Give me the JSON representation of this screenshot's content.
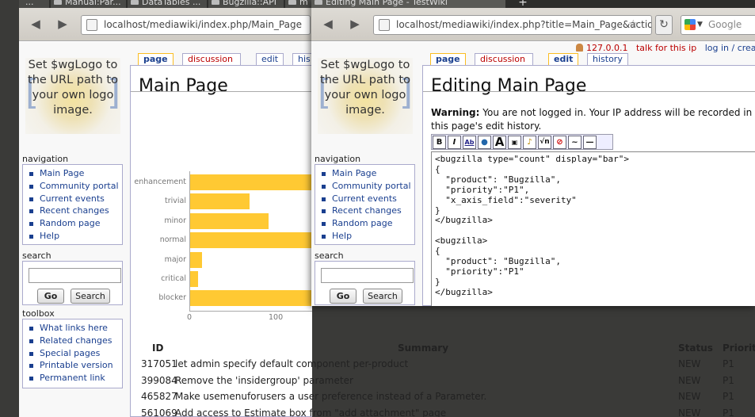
{
  "back_window": {
    "tabs": [
      "...",
      "Manual:Par...",
      "DataTables ...",
      "Bugzilla::API",
      "m"
    ],
    "url": "localhost/mediawiki/index.php/Main_Page",
    "page_tabs": {
      "page": "page",
      "discussion": "discussion",
      "edit": "edit",
      "history": "his"
    },
    "title": "Main Page",
    "bug_table": {
      "headers": {
        "id": "ID",
        "summary": "Summary",
        "status": "Status",
        "priority": "Priorit"
      },
      "rows": [
        {
          "id": "317051",
          "summary": "let admin specify default component per-product",
          "status": "NEW",
          "priority": "P1"
        },
        {
          "id": "399084",
          "summary": "Remove the 'insidergroup' parameter",
          "status": "NEW",
          "priority": "P1"
        },
        {
          "id": "465827",
          "summary": "Make usemenuforusers a user preference instead of a Parameter.",
          "status": "NEW",
          "priority": "P1"
        },
        {
          "id": "561069",
          "summary": "Add access to Estimate box from \"add attachment\" page",
          "status": "NEW",
          "priority": "P1"
        }
      ]
    }
  },
  "front_window": {
    "tab_title": "Editing Main Page - TestWiki",
    "url": "localhost/mediawiki/index.php?title=Main_Page&action",
    "search_placeholder": "Google",
    "top_links": {
      "ip": "127.0.0.1",
      "talk": "talk for this ip",
      "login": "log in / creat"
    },
    "page_tabs": {
      "page": "page",
      "discussion": "discussion",
      "edit": "edit",
      "history": "history"
    },
    "title": "Editing Main Page",
    "warning_label": "Warning:",
    "warning_text": "You are not logged in. Your IP address will be recorded in this page's edit history.",
    "editor_text": "<bugzilla type=\"count\" display=\"bar\">\n{\n  \"product\": \"Bugzilla\",\n  \"priority\":\"P1\",\n  \"x_axis_field\":\"severity\"\n}\n</bugzilla>\n\n<bugzilla>\n{\n  \"product\": \"Bugzilla\",\n  \"priority\":\"P1\"\n}\n</bugzilla>",
    "toolbar_buttons": [
      "B",
      "I",
      "Ab",
      "globe",
      "A",
      "img",
      "media",
      "sqrt",
      "nowiki",
      "sig",
      "hr"
    ]
  },
  "sidebar": {
    "logo_text": "Set $wgLogo to the URL path to your own logo image.",
    "navigation_heading": "navigation",
    "navigation_items": [
      "Main Page",
      "Community portal",
      "Current events",
      "Recent changes",
      "Random page",
      "Help"
    ],
    "search_heading": "search",
    "go_label": "Go",
    "search_label": "Search",
    "toolbox_heading": "toolbox",
    "toolbox_items": [
      "What links here",
      "Related changes",
      "Special pages",
      "Printable version",
      "Permanent link"
    ]
  },
  "chart_data": {
    "type": "bar",
    "orientation": "horizontal",
    "categories": [
      "enhancement",
      "trivial",
      "minor",
      "normal",
      "major",
      "critical",
      "blocker"
    ],
    "values": [
      157,
      70,
      92,
      168,
      15,
      10,
      225
    ],
    "xlim": [
      0,
      235
    ],
    "xticks": [
      "0",
      "100",
      "200"
    ],
    "bar_color": "#ffc933"
  }
}
